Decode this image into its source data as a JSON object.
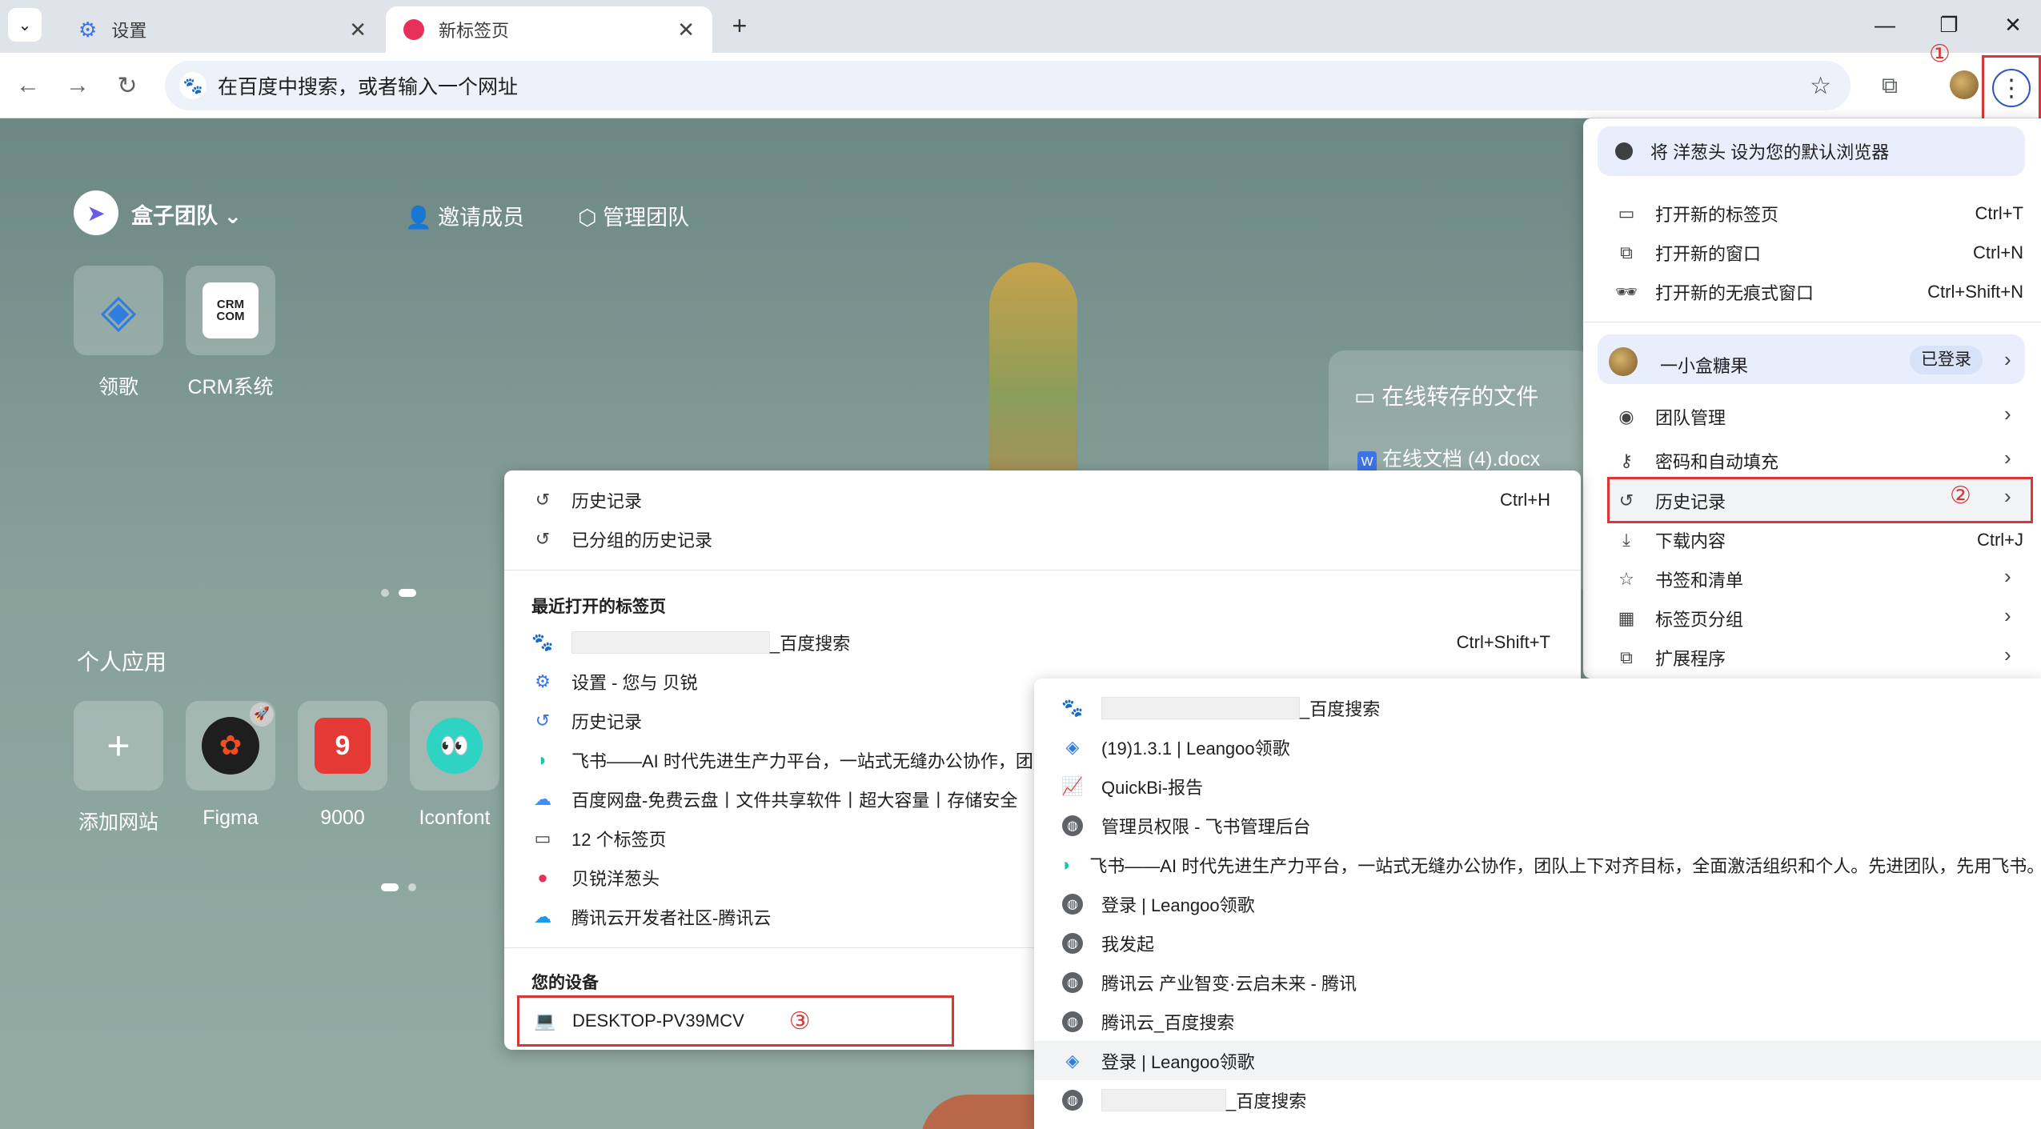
{
  "tabs": [
    {
      "title": "设置",
      "icon": "gear-icon"
    },
    {
      "title": "新标签页",
      "icon": "onion-icon"
    }
  ],
  "window": {
    "minimize": "—",
    "restore": "❐",
    "close": "✕"
  },
  "address": {
    "text": "在百度中搜索，或者输入一个网址"
  },
  "annotations": [
    "①",
    "②",
    "③"
  ],
  "newtab": {
    "team": "盒子团队",
    "invite": "邀请成员",
    "manage": "管理团队",
    "team_apps": [
      "领歌",
      "CRM系统"
    ],
    "crm_logo": "CRM\nCOM",
    "online_title": "在线转存的文件",
    "online_file": "在线文档 (4).docx",
    "personal_title": "个人应用",
    "personal_apps": [
      "添加网站",
      "Figma",
      "9000",
      "Iconfont"
    ],
    "app_9000_badge": "9"
  },
  "main_menu": {
    "banner": "将 洋葱头 设为您的默认浏览器",
    "new_tab": "打开新的标签页",
    "new_tab_sc": "Ctrl+T",
    "new_window": "打开新的窗口",
    "new_window_sc": "Ctrl+N",
    "incognito": "打开新的无痕式窗口",
    "incognito_sc": "Ctrl+Shift+N",
    "profile_name": "一小盒糖果",
    "profile_status": "已登录",
    "team_manage": "团队管理",
    "passwords": "密码和自动填充",
    "history": "历史记录",
    "downloads": "下载内容",
    "downloads_sc": "Ctrl+J",
    "bookmarks": "书签和清单",
    "tab_groups": "标签页分组",
    "extensions": "扩展程序"
  },
  "history_menu": {
    "history": "历史记录",
    "history_sc": "Ctrl+H",
    "grouped": "已分组的历史记录",
    "recent_title": "最近打开的标签页",
    "recent_items": [
      {
        "text": "_百度搜索",
        "blank": true
      },
      {
        "text": "设置 - 您与 贝锐"
      },
      {
        "text": "历史记录"
      },
      {
        "text": "飞书——AI 时代先进生产力平台，一站式无缝办公协作，团队"
      },
      {
        "text": "百度网盘-免费云盘丨文件共享软件丨超大容量丨存储安全"
      },
      {
        "text": "12 个标签页"
      },
      {
        "text": "贝锐洋葱头"
      },
      {
        "text": "腾讯云开发者社区-腾讯云"
      }
    ],
    "reopen_sc": "Ctrl+Shift+T",
    "devices_title": "您的设备",
    "device": "DESKTOP-PV39MCV"
  },
  "device_menu": {
    "items": [
      {
        "text": "_百度搜索",
        "blank": true
      },
      {
        "text": "(19)1.3.1 | Leangoo领歌"
      },
      {
        "text": "QuickBi-报告"
      },
      {
        "text": "管理员权限 - 飞书管理后台"
      },
      {
        "text": "飞书——AI 时代先进生产力平台，一站式无缝办公协作，团队上下对齐目标，全面激活组织和个人。先进团队，先用飞书。"
      },
      {
        "text": "登录 | Leangoo领歌"
      },
      {
        "text": "我发起"
      },
      {
        "text": "腾讯云 产业智变·云启未来 - 腾讯"
      },
      {
        "text": "腾讯云_百度搜索"
      },
      {
        "text": "登录 | Leangoo领歌"
      },
      {
        "text": "_百度搜索",
        "blank": true
      }
    ]
  }
}
